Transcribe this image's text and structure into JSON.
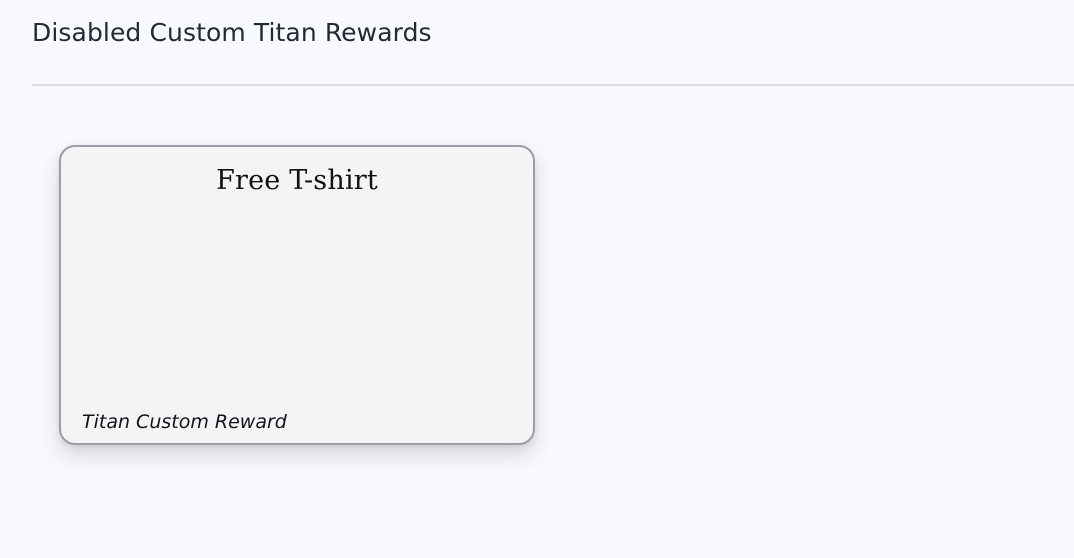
{
  "section": {
    "title": "Disabled Custom Titan Rewards"
  },
  "rewards": [
    {
      "title": "Free T-shirt",
      "type_label": "Titan Custom Reward"
    }
  ]
}
